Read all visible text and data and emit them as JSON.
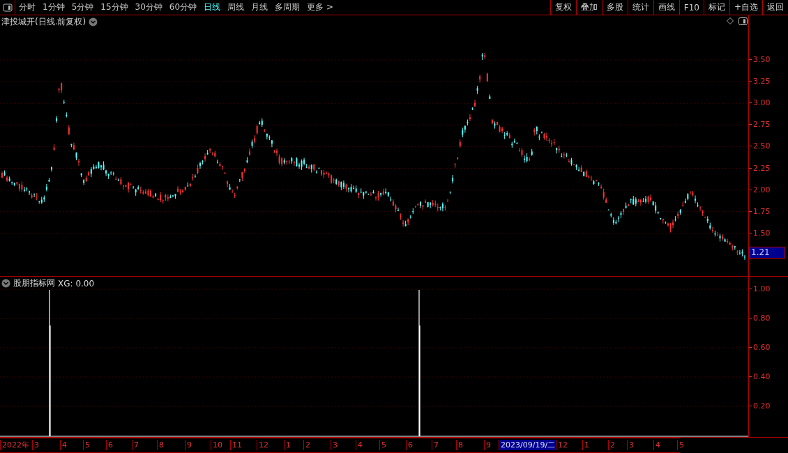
{
  "toolbar": {
    "periods": [
      {
        "label": "分时",
        "selected": false
      },
      {
        "label": "1分钟",
        "selected": false
      },
      {
        "label": "5分钟",
        "selected": false
      },
      {
        "label": "15分钟",
        "selected": false
      },
      {
        "label": "30分钟",
        "selected": false
      },
      {
        "label": "60分钟",
        "selected": false
      },
      {
        "label": "日线",
        "selected": true
      },
      {
        "label": "周线",
        "selected": false
      },
      {
        "label": "月线",
        "selected": false
      },
      {
        "label": "多周期",
        "selected": false
      },
      {
        "label": "更多 >",
        "selected": false
      }
    ],
    "buttons": [
      "复权",
      "叠加",
      "多股",
      "统计",
      "画线",
      "F10",
      "标记",
      "+自选",
      "返回"
    ]
  },
  "main_pane": {
    "title": "津投城开(日线.前复权)",
    "price_ticks": [
      "3.50",
      "3.25",
      "3.00",
      "2.75",
      "2.50",
      "2.25",
      "2.00",
      "1.75",
      "1.50"
    ],
    "current_price": "1.21"
  },
  "indicator_pane": {
    "name": "股朋指标网",
    "reading": "XG: 0.00",
    "ticks": [
      "1.00",
      "0.80",
      "0.60",
      "0.40",
      "0.20"
    ]
  },
  "date_axis": [
    {
      "label": "2022年",
      "kind": "month"
    },
    {
      "label": "3",
      "kind": "month"
    },
    {
      "label": "4",
      "kind": "month"
    },
    {
      "label": "5",
      "kind": "month"
    },
    {
      "label": "6",
      "kind": "month"
    },
    {
      "label": "7",
      "kind": "month"
    },
    {
      "label": "8",
      "kind": "month"
    },
    {
      "label": "9",
      "kind": "month"
    },
    {
      "label": "10",
      "kind": "month"
    },
    {
      "label": "11",
      "kind": "month"
    },
    {
      "label": "12",
      "kind": "month"
    },
    {
      "label": "1",
      "kind": "month"
    },
    {
      "label": "2",
      "kind": "month"
    },
    {
      "label": "3",
      "kind": "month"
    },
    {
      "label": "4",
      "kind": "month"
    },
    {
      "label": "5",
      "kind": "month"
    },
    {
      "label": "6",
      "kind": "month"
    },
    {
      "label": "7",
      "kind": "month"
    },
    {
      "label": "8",
      "kind": "month"
    },
    {
      "label": "9",
      "kind": "month"
    },
    {
      "label": "2023/09/19/二",
      "kind": "cursor"
    },
    {
      "label": "12",
      "kind": "month"
    },
    {
      "label": "1",
      "kind": "month"
    },
    {
      "label": "2",
      "kind": "month"
    },
    {
      "label": "3",
      "kind": "month"
    },
    {
      "label": "4",
      "kind": "month"
    },
    {
      "label": "5",
      "kind": "month"
    }
  ]
}
